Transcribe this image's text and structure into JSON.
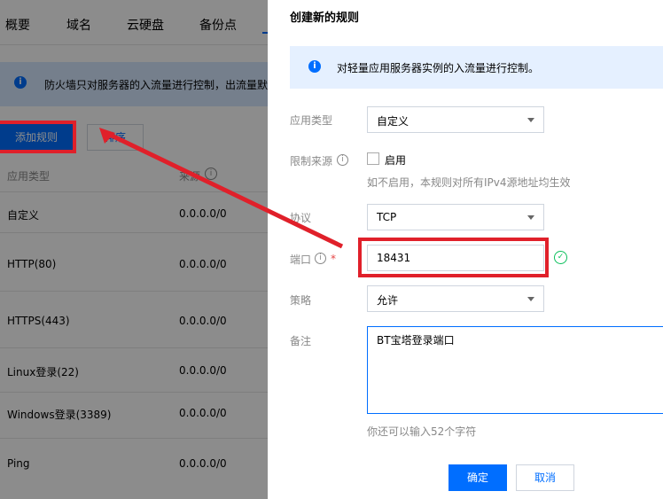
{
  "background": {
    "tabs": [
      "概要",
      "域名",
      "云硬盘",
      "备份点"
    ],
    "notice": "防火墙只对服务器的入流量进行控制，出流量默",
    "add_button": "添加规则",
    "sort_button": "排序",
    "columns": [
      "应用类型",
      "来源"
    ],
    "rows": [
      {
        "type": "自定义",
        "source": "0.0.0.0/0"
      },
      {
        "type": "HTTP(80)",
        "source": "0.0.0.0/0"
      },
      {
        "type": "HTTPS(443)",
        "source": "0.0.0.0/0"
      },
      {
        "type": "Linux登录(22)",
        "source": "0.0.0.0/0"
      },
      {
        "type": "Windows登录(3389)",
        "source": "0.0.0.0/0"
      },
      {
        "type": "Ping",
        "source": "0.0.0.0/0"
      }
    ]
  },
  "dialog": {
    "title": "创建新的规则",
    "info": "对轻量应用服务器实例的入流量进行控制。",
    "app_type_label": "应用类型",
    "app_type_value": "自定义",
    "source_label": "限制来源",
    "enable_label": "启用",
    "source_hint": "如不启用，本规则对所有IPv4源地址均生效",
    "protocol_label": "协议",
    "protocol_value": "TCP",
    "port_label": "端口",
    "port_value": "18431",
    "policy_label": "策略",
    "policy_value": "允许",
    "remark_label": "备注",
    "remark_value": "BT宝塔登录端口",
    "remark_hint": "你还可以输入52个字符",
    "confirm_button": "确定",
    "cancel_button": "取消"
  },
  "colors": {
    "primary": "#006eff",
    "annotation_red": "#e0202a",
    "success": "#0abf5b"
  },
  "icons": [
    "info-icon",
    "question-icon",
    "chevron-down-icon",
    "check-circle-icon",
    "arrow-annotation"
  ]
}
